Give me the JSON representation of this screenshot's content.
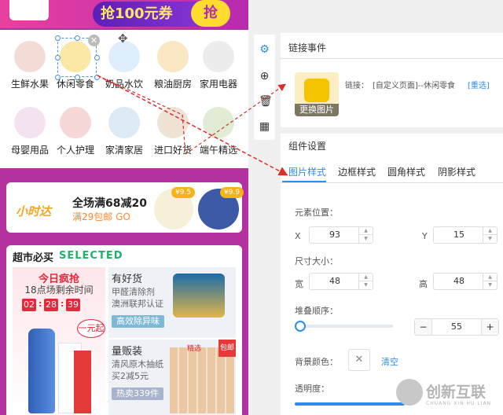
{
  "banner": {
    "text": "抢100元券",
    "circle": "抢"
  },
  "categories": [
    {
      "label": "生鲜水果",
      "color": "#f4dcd6",
      "icon": "lychee-icon"
    },
    {
      "label": "休闲零食",
      "color": "#fbe7a6",
      "icon": "snack-icon"
    },
    {
      "label": "奶品水饮",
      "color": "#dfeefc",
      "icon": "milk-icon"
    },
    {
      "label": "粮油厨房",
      "color": "#fbe6c4",
      "icon": "oil-icon"
    },
    {
      "label": "家用电器",
      "color": "#ececec",
      "icon": "kettle-icon"
    },
    {
      "label": "母婴用品",
      "color": "#f3e3f0",
      "icon": "baby-icon"
    },
    {
      "label": "个人护理",
      "color": "#f6d8d8",
      "icon": "shampoo-icon"
    },
    {
      "label": "家清家居",
      "color": "#dbeaf5",
      "icon": "detergent-icon"
    },
    {
      "label": "进口好货",
      "color": "#efe3d6",
      "icon": "cookie-icon"
    },
    {
      "label": "端午精选",
      "color": "#e2ecd5",
      "icon": "zongzi-icon"
    }
  ],
  "promo": {
    "logo": "小时达",
    "title": "全场满68减20",
    "sub": "满29包邮 GO",
    "price1": "¥9.5",
    "price2": "¥9.9"
  },
  "market": {
    "title": "超市必买",
    "selected": "SELECTED",
    "flash_title": "今日疯抢",
    "flash_sub": "18点场剩余时间",
    "clock": [
      "02",
      "28",
      "39"
    ],
    "badge": "一元起",
    "card1": {
      "title": "有好货",
      "line1": "甲醛清除剂",
      "line2": "澳洲联邦认证",
      "button": "高效除异味"
    },
    "card2": {
      "title": "量贩装",
      "line1": "清风原木抽纸",
      "line2": "买2减5元",
      "button": "热卖339件",
      "tag": "精选",
      "corner": "包邮"
    }
  },
  "toolbar": {
    "icons": [
      "gear-icon",
      "add-icon",
      "trash-icon",
      "grid-icon"
    ]
  },
  "panel": {
    "link_section": "链接事件",
    "change_image": "更换图片",
    "link_label": "链接：",
    "link_value": "[自定义页面]--休闲零食",
    "link_reselect": "[重选]",
    "settings_section": "组件设置",
    "tabs": [
      "图片样式",
      "边框样式",
      "圆角样式",
      "阴影样式"
    ],
    "position_label": "元素位置：",
    "x_label": "X",
    "x_value": "93",
    "y_label": "Y",
    "y_value": "15",
    "size_label": "尺寸大小：",
    "w_label": "宽",
    "w_value": "48",
    "h_label": "高",
    "h_value": "48",
    "z_label": "堆叠顺序：",
    "z_value": "55",
    "bg_label": "背景颜色：",
    "clear": "清空",
    "opacity_label": "透明度：",
    "opacity": 1.0
  },
  "watermark": {
    "title": "创新互联",
    "sub": "CHUANG XIN HU LIAN"
  },
  "colors": {
    "accent": "#2d8cf0",
    "arrow": "#d9302b",
    "brand": "#b4329f"
  }
}
